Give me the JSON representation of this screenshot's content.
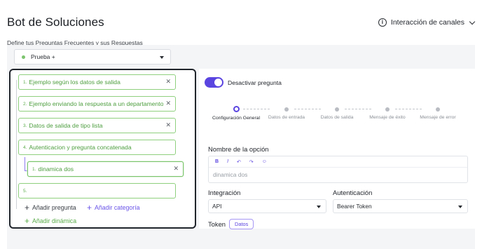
{
  "header": {
    "title": "Bot de Soluciones",
    "channels_label": "Interacción de canales"
  },
  "subtitle": "Define tus Preguntas Frecuentes y sus Respuestas",
  "selector": {
    "value": "Prueba +"
  },
  "questions": [
    {
      "num": "1.",
      "text": "Ejemplo según los datos de salida"
    },
    {
      "num": "2.",
      "text": "Ejemplo enviando la respuesta a un departamento"
    },
    {
      "num": "3.",
      "text": "Datos de salida de tipo lista"
    },
    {
      "num": "4.",
      "text": "Autenticacion y pregunta concatenada"
    },
    {
      "num": "1.",
      "text": "dinamica dos"
    },
    {
      "num": "5.",
      "text": ""
    }
  ],
  "actions": {
    "add_question": "Añadir pregunta",
    "add_category": "Añadir categoría",
    "add_dynamic": "Añadir dinámica"
  },
  "toggle": {
    "label": "Desactivar pregunta",
    "on": true
  },
  "steps": [
    {
      "label": "Configuración General",
      "active": true
    },
    {
      "label": "Datos de entrada",
      "active": false
    },
    {
      "label": "Datos de salida",
      "active": false
    },
    {
      "label": "Mensaje de éxito",
      "active": false
    },
    {
      "label": "Mensaje de error",
      "active": false
    }
  ],
  "form": {
    "option_name_label": "Nombre de la opción",
    "toolbar": {
      "bold": "B",
      "italic": "I",
      "undo": "↶",
      "redo": "↷",
      "emoji": "☺"
    },
    "option_name_value": "dinamica dos",
    "integration_label": "Integración",
    "integration_value": "API",
    "auth_label": "Autenticación",
    "auth_value": "Bearer Token",
    "token_label": "Token",
    "token_chip": "Datos"
  },
  "colors": {
    "accent": "#5b45e0",
    "green": "#4d9e3f",
    "green_border": "#8fd07f"
  }
}
